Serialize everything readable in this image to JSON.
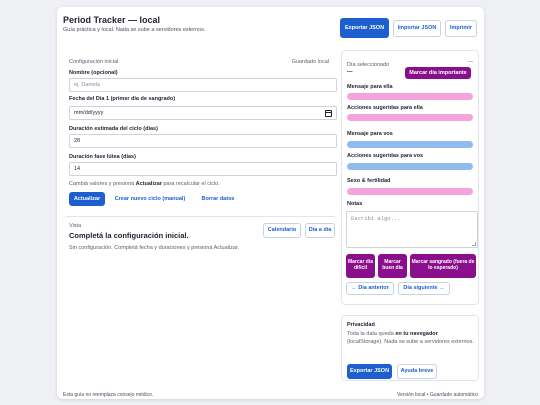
{
  "header": {
    "title": "Period Tracker — local",
    "subtitle": "Guía práctica y local. Nada se sube a servidores externos.",
    "export_label": "Exportar JSON",
    "import_label": "Importar JSON",
    "print_label": "Imprimir"
  },
  "config": {
    "heading": "Configuración inicial",
    "saved_label": "Guardado local",
    "name_label": "Nombre (opcional)",
    "name_placeholder": "ej. Daniela",
    "date_label": "Fecha del Día 1 (primer día de sangrado)",
    "date_placeholder": "mm/dd/yyyy",
    "cycle_label": "Duración estimada del ciclo (días)",
    "cycle_value": "28",
    "luteal_label": "Duración fase lútea (días)",
    "luteal_value": "14",
    "hint_pre": "Cambiá valores y presioná ",
    "hint_bold": "Actualizar",
    "hint_post": " para recalcular el ciclo.",
    "update_label": "Actualizar",
    "new_cycle_label": "Crear nuevo ciclo (manual)",
    "delete_label": "Borrar datos"
  },
  "view": {
    "label": "Vista",
    "title": "Completá la configuración inicial.",
    "message": "Sin configuración. Completá fecha y duraciones y presioná Actualizar.",
    "calendar_label": "Calendario",
    "day_label": "Día a día"
  },
  "day_panel": {
    "selected_label": "Día seleccionado",
    "selected_value": "—",
    "selected_more": "—",
    "mark_important_label": "Marcar día importante",
    "sections": [
      {
        "label": "Mensaje para ella",
        "color": "#f5a3dc"
      },
      {
        "label": "Acciones sugeridas para ella",
        "color": "#f5a3dc"
      },
      {
        "label": "Mensaje para vos",
        "color": "#8fbcf0"
      },
      {
        "label": "Acciones sugeridas para vos",
        "color": "#8fbcf0"
      },
      {
        "label": "Sexo & fertilidad",
        "color": "#f5a3dc"
      }
    ],
    "notes_label": "Notas",
    "notes_placeholder": "Escribí algo...",
    "difficult_label": "Marcar día difícil",
    "good_label": "Marcar buen día",
    "bleeding_label": "Marcar sangrado (fuera de lo esperado)",
    "prev_label": "← Día anterior",
    "next_label": "Día siguiente →"
  },
  "privacy": {
    "heading": "Privacidad",
    "text_pre": "Toda la data queda ",
    "text_bold": "en tu navegador",
    "text_post": " (localStorage). Nada se sube a servidores externos.",
    "export_label": "Exportar JSON",
    "help_label": "Ayuda breve"
  },
  "footer": {
    "disclaimer": "Esta guía no reemplaza consejo médico.",
    "status": "Versión local • Guardado automático"
  },
  "colors": {
    "primary": "#1e5fd0",
    "accent_purple": "#8a0f8c",
    "pink": "#f5a3dc",
    "blue": "#8fbcf0"
  }
}
